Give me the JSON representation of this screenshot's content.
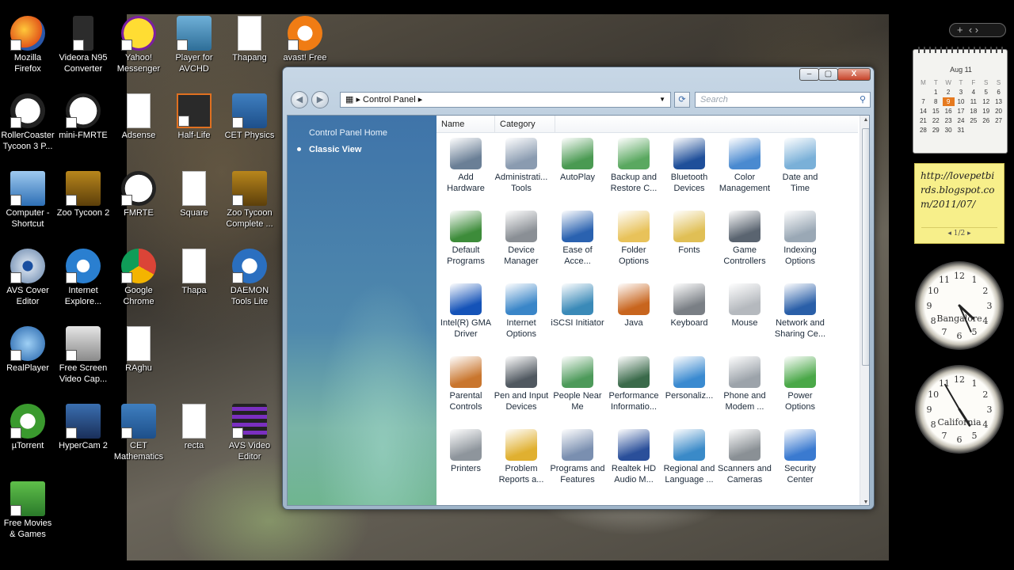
{
  "desktop_icons": [
    {
      "label": "Mozilla Firefox",
      "icon": "firefox-icon"
    },
    {
      "label": "Videora N95 Converter",
      "icon": "phone-icon"
    },
    {
      "label": "Yahoo! Messenger",
      "icon": "yahoo-icon"
    },
    {
      "label": "Player for AVCHD",
      "icon": "player-icon"
    },
    {
      "label": "Thapang",
      "icon": "document-icon"
    },
    {
      "label": "avast! Free",
      "icon": "avast-icon"
    },
    {
      "label": "RollerCoaster Tycoon 3 P...",
      "icon": "panda-icon"
    },
    {
      "label": "mini-FMRTE",
      "icon": "soccer-ball-icon"
    },
    {
      "label": "Adsense",
      "icon": "document-icon"
    },
    {
      "label": "Half-Life",
      "icon": "half-life-icon"
    },
    {
      "label": "CET Physics",
      "icon": "ie-e-icon"
    },
    {
      "label": "Computer - Shortcut",
      "icon": "computer-icon"
    },
    {
      "label": "Zoo Tycoon 2",
      "icon": "zoo-tycoon-icon"
    },
    {
      "label": "FMRTE",
      "icon": "soccer-ball-icon"
    },
    {
      "label": "Square",
      "icon": "document-icon"
    },
    {
      "label": "Zoo Tycoon Complete ...",
      "icon": "zoo-tycoon-icon"
    },
    {
      "label": "AVS Cover Editor",
      "icon": "cd-icon"
    },
    {
      "label": "Internet Explore...",
      "icon": "internet-explorer-icon"
    },
    {
      "label": "Google Chrome",
      "icon": "chrome-icon"
    },
    {
      "label": "Thapa",
      "icon": "document-icon"
    },
    {
      "label": "DAEMON Tools Lite",
      "icon": "daemon-tools-icon"
    },
    {
      "label": "RealPlayer",
      "icon": "realplayer-icon"
    },
    {
      "label": "Free Screen Video Cap...",
      "icon": "camera-icon"
    },
    {
      "label": "RAghu",
      "icon": "document-icon"
    },
    {
      "label": "µTorrent",
      "icon": "utorrent-icon"
    },
    {
      "label": "HyperCam 2",
      "icon": "hypercam-icon"
    },
    {
      "label": "CET Mathematics",
      "icon": "ie-e-icon"
    },
    {
      "label": "recta",
      "icon": "document-icon"
    },
    {
      "label": "AVS Video Editor",
      "icon": "film-icon"
    },
    {
      "label": "Free Movies & Games",
      "icon": "gift-icon"
    }
  ],
  "window": {
    "address": "Control Panel",
    "search_placeholder": "Search",
    "close_label": "X",
    "sidebar": {
      "home": "Control Panel Home",
      "classic": "Classic View"
    },
    "columns": [
      "Name",
      "Category"
    ],
    "items": [
      {
        "label": "Add Hardware",
        "icon": "add-hardware-icon",
        "color": "#6a7f96"
      },
      {
        "label": "Administrati... Tools",
        "icon": "admin-tools-icon",
        "color": "#8a9bb0"
      },
      {
        "label": "AutoPlay",
        "icon": "autoplay-icon",
        "color": "#4a9a52"
      },
      {
        "label": "Backup and Restore C...",
        "icon": "backup-icon",
        "color": "#5aa860"
      },
      {
        "label": "Bluetooth Devices",
        "icon": "bluetooth-icon",
        "color": "#1f4f9a"
      },
      {
        "label": "Color Management",
        "icon": "color-management-icon",
        "color": "#4a8ad0"
      },
      {
        "label": "Date and Time",
        "icon": "date-time-icon",
        "color": "#7ab0d8"
      },
      {
        "label": "Default Programs",
        "icon": "default-programs-icon",
        "color": "#3d8c3a"
      },
      {
        "label": "Device Manager",
        "icon": "device-manager-icon",
        "color": "#8a8f95"
      },
      {
        "label": "Ease of Acce...",
        "icon": "ease-of-access-icon",
        "color": "#2a62b0"
      },
      {
        "label": "Folder Options",
        "icon": "folder-options-icon",
        "color": "#e8c25a"
      },
      {
        "label": "Fonts",
        "icon": "fonts-icon",
        "color": "#e0bf55"
      },
      {
        "label": "Game Controllers",
        "icon": "game-controller-icon",
        "color": "#5a6470"
      },
      {
        "label": "Indexing Options",
        "icon": "indexing-icon",
        "color": "#9aa8b5"
      },
      {
        "label": "Intel(R) GMA Driver",
        "icon": "intel-gma-icon",
        "color": "#1553b8"
      },
      {
        "label": "Internet Options",
        "icon": "internet-options-icon",
        "color": "#3a86c8"
      },
      {
        "label": "iSCSI Initiator",
        "icon": "iscsi-icon",
        "color": "#3a8ab8"
      },
      {
        "label": "Java",
        "icon": "java-icon",
        "color": "#c8651e"
      },
      {
        "label": "Keyboard",
        "icon": "keyboard-icon",
        "color": "#7a7f85"
      },
      {
        "label": "Mouse",
        "icon": "mouse-icon",
        "color": "#b5b9be"
      },
      {
        "label": "Network and Sharing Ce...",
        "icon": "network-icon",
        "color": "#2a5fa8"
      },
      {
        "label": "Parental Controls",
        "icon": "parental-controls-icon",
        "color": "#c9762e"
      },
      {
        "label": "Pen and Input Devices",
        "icon": "pen-icon",
        "color": "#505860"
      },
      {
        "label": "People Near Me",
        "icon": "people-near-me-icon",
        "color": "#4d9a5a"
      },
      {
        "label": "Performance Informatio...",
        "icon": "performance-icon",
        "color": "#3a6a4a"
      },
      {
        "label": "Personaliz...",
        "icon": "personalization-icon",
        "color": "#3a8ad0"
      },
      {
        "label": "Phone and Modem ...",
        "icon": "phone-modem-icon",
        "color": "#9ca3aa"
      },
      {
        "label": "Power Options",
        "icon": "power-options-icon",
        "color": "#4aa848"
      },
      {
        "label": "Printers",
        "icon": "printer-icon",
        "color": "#8e959c"
      },
      {
        "label": "Problem Reports a...",
        "icon": "problem-reports-icon",
        "color": "#e0b030"
      },
      {
        "label": "Programs and Features",
        "icon": "programs-features-icon",
        "color": "#7a8fb0"
      },
      {
        "label": "Realtek HD Audio M...",
        "icon": "realtek-audio-icon",
        "color": "#2a4f9a"
      },
      {
        "label": "Regional and Language ...",
        "icon": "regional-language-icon",
        "color": "#3a8ac8"
      },
      {
        "label": "Scanners and Cameras",
        "icon": "scanner-icon",
        "color": "#8a9095"
      },
      {
        "label": "Security Center",
        "icon": "security-center-icon",
        "color": "#3a7ad0"
      }
    ]
  },
  "gadgets": {
    "calendar": {
      "month": "Aug 11",
      "weekdays": [
        "M",
        "T",
        "W",
        "T",
        "F",
        "S",
        "S"
      ],
      "days": [
        "",
        "1",
        "2",
        "3",
        "4",
        "5",
        "6",
        "7",
        "8",
        "9",
        "10",
        "11",
        "12",
        "13",
        "14",
        "15",
        "16",
        "17",
        "18",
        "19",
        "20",
        "21",
        "22",
        "23",
        "24",
        "25",
        "26",
        "27",
        "28",
        "29",
        "30",
        "31"
      ],
      "today": "9"
    },
    "note": {
      "text": "http://lovepetbirds.blogspot.com/2011/07/",
      "pager": "1/2"
    },
    "clocks": [
      {
        "city": "Bangalore",
        "hour": 4,
        "minute": 26
      },
      {
        "city": "California",
        "hour": 4,
        "minute": 55
      }
    ]
  }
}
